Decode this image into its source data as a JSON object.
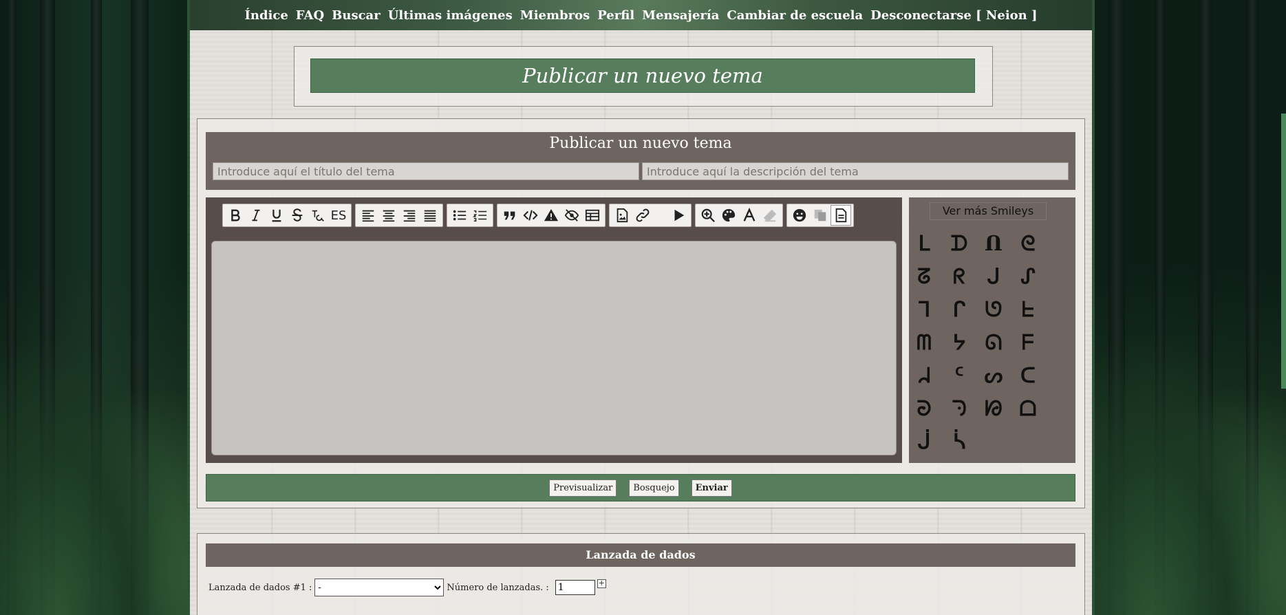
{
  "nav": {
    "items": [
      "Índice",
      "FAQ",
      "Buscar",
      "Últimas imágenes",
      "Miembros",
      "Perfil",
      "Mensajería",
      "Cambiar de escuela",
      "Desconectarse [ Neion ]"
    ]
  },
  "page_title": "Publicar un nuevo tema",
  "form": {
    "header": "Publicar un nuevo tema",
    "title_placeholder": "Introduce aquí el título del tema",
    "description_placeholder": "Introduce aquí la descripción del tema"
  },
  "toolbar": {
    "groups": [
      [
        "bold-icon",
        "italic-icon",
        "underline-icon",
        "strikethrough-icon",
        "superscript-icon",
        "spellcheck-icon"
      ],
      [
        "align-left-icon",
        "align-center-icon",
        "align-right-icon",
        "align-justify-icon"
      ],
      [
        "bullet-list-icon",
        "numbered-list-icon"
      ],
      [
        "quote-icon",
        "code-icon",
        "warning-icon",
        "hide-icon",
        "table-icon"
      ],
      [
        "image-icon",
        "link-icon",
        "play-icon"
      ],
      [
        "zoom-icon",
        "palette-icon",
        "font-icon",
        "eraser-icon"
      ],
      [
        "smiley-icon",
        "copy-icon",
        "document-icon"
      ]
    ],
    "spellcheck_label": "ES"
  },
  "smileys": {
    "more_label": "Ver más Smileys",
    "glyphs": [
      "ᒪ",
      "ᗪ",
      "Ո",
      "ᘓ",
      "ᘔ",
      "ᖇ",
      "ᒍ",
      "ᔑ",
      "ᒣ",
      "ᒋ",
      "ᘎ",
      "ᖶ",
      "ᗰ",
      "ᔭ",
      "ᘏ",
      "ᖴ",
      "ᖹ",
      "ᑦ",
      "ᔕ",
      "ᑕ",
      "ᘒ",
      "ᘆ",
      "ᘙ",
      "ᗝ",
      "ᒎ",
      "ᓵ"
    ]
  },
  "actions": {
    "preview": "Previsualizar",
    "draft": "Bosquejo",
    "submit": "Enviar"
  },
  "dice": {
    "header": "Lanzada de dados",
    "label": "Lanzada de dados #1 :",
    "selected": "-",
    "count_label": "Número de lanzadas. :",
    "count_value": "1",
    "add_label": "+"
  }
}
